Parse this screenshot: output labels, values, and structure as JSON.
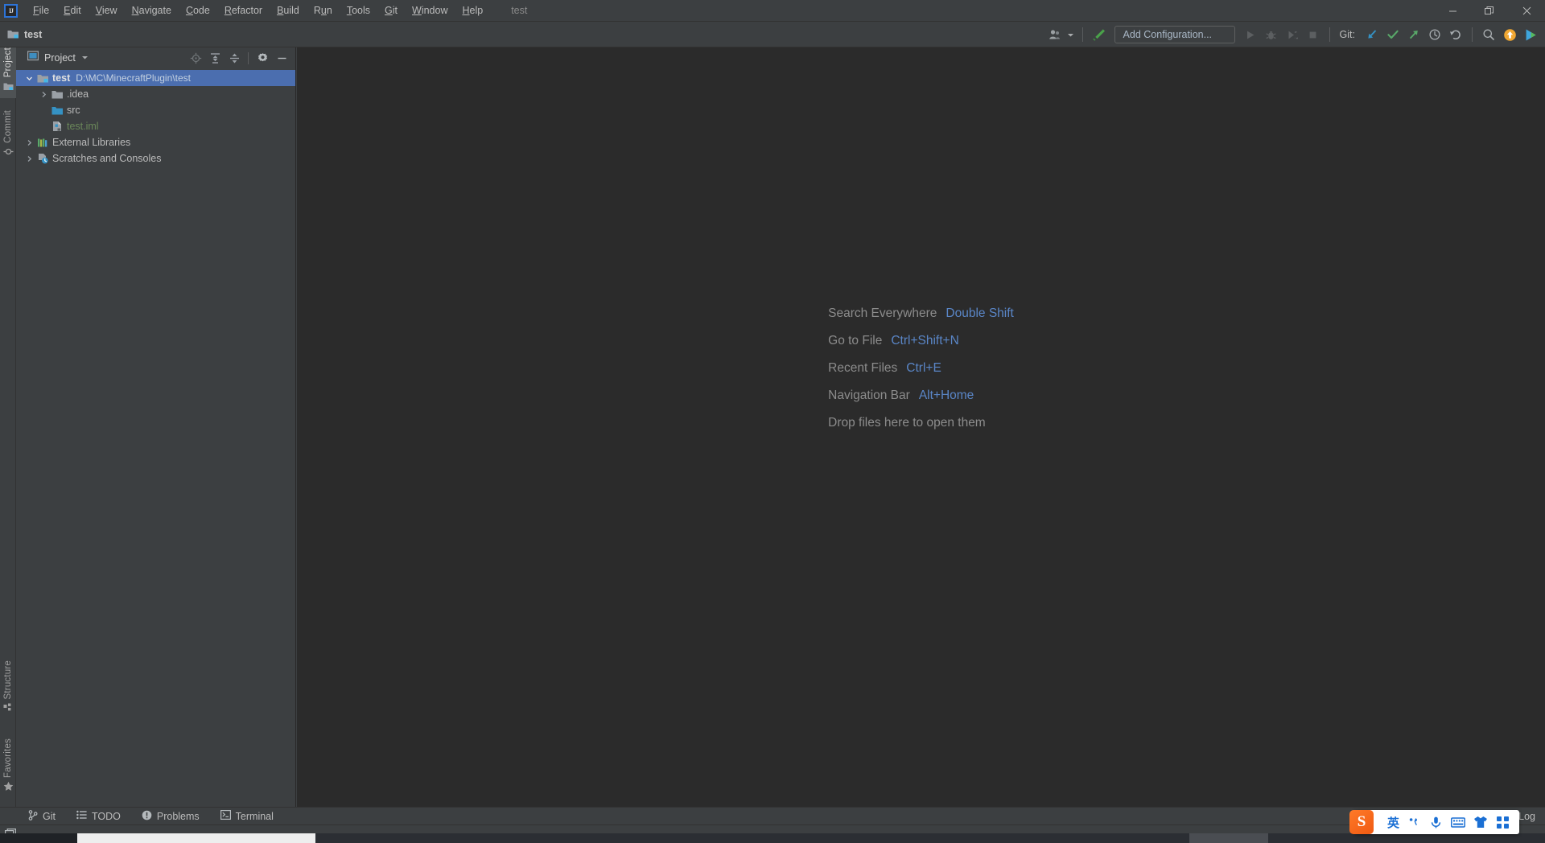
{
  "window": {
    "title": "test",
    "controls": {
      "minimize": "minimize-button",
      "restore": "restore-button",
      "close": "close-button"
    }
  },
  "menubar": {
    "items": [
      {
        "label": "File",
        "mnemonic": "F"
      },
      {
        "label": "Edit",
        "mnemonic": "E"
      },
      {
        "label": "View",
        "mnemonic": "V"
      },
      {
        "label": "Navigate",
        "mnemonic": "N"
      },
      {
        "label": "Code",
        "mnemonic": "C"
      },
      {
        "label": "Refactor",
        "mnemonic": "R"
      },
      {
        "label": "Build",
        "mnemonic": "B"
      },
      {
        "label": "Run",
        "mnemonic": "u"
      },
      {
        "label": "Tools",
        "mnemonic": "T"
      },
      {
        "label": "Git",
        "mnemonic": "G"
      },
      {
        "label": "Window",
        "mnemonic": "W"
      },
      {
        "label": "Help",
        "mnemonic": "H"
      }
    ],
    "logo_text": "IJ"
  },
  "navbar": {
    "project_name": "test"
  },
  "toolbar": {
    "run_configuration_label": "Add Configuration...",
    "git_label": "Git:",
    "buttons": [
      {
        "name": "profiler-icon",
        "enabled": true
      },
      {
        "name": "chevron-down-icon",
        "enabled": true
      },
      {
        "name": "build-hammer-icon",
        "enabled": true
      },
      {
        "name": "run-icon",
        "enabled": false
      },
      {
        "name": "debug-icon",
        "enabled": false
      },
      {
        "name": "run-with-coverage-icon",
        "enabled": false
      },
      {
        "name": "stop-icon",
        "enabled": false
      },
      {
        "name": "git-update-icon",
        "enabled": true
      },
      {
        "name": "git-commit-icon",
        "enabled": true
      },
      {
        "name": "git-push-icon",
        "enabled": true
      },
      {
        "name": "git-history-icon",
        "enabled": true
      },
      {
        "name": "git-rollback-icon",
        "enabled": true
      },
      {
        "name": "search-everywhere-icon",
        "enabled": true
      },
      {
        "name": "updates-available-icon",
        "enabled": true
      },
      {
        "name": "ide-play-icon",
        "enabled": true
      }
    ]
  },
  "stripe": {
    "left_top": [
      {
        "label": "Project",
        "icon": "project-folder-icon",
        "active": true
      },
      {
        "label": "Commit",
        "icon": "commit-icon",
        "active": false
      }
    ],
    "left_bottom": [
      {
        "label": "Structure",
        "icon": "structure-grid-icon",
        "active": false
      },
      {
        "label": "Favorites",
        "icon": "star-icon",
        "active": false
      }
    ]
  },
  "project_panel": {
    "title": "Project",
    "actions": [
      {
        "name": "select-opened-file-icon"
      },
      {
        "name": "expand-all-icon"
      },
      {
        "name": "collapse-all-icon"
      },
      {
        "name": "settings-gear-icon"
      },
      {
        "name": "hide-panel-icon"
      }
    ],
    "tree": [
      {
        "name": "test",
        "path": "D:\\MC\\MinecraftPlugin\\test",
        "icon": "module-folder-icon",
        "depth": 0,
        "expanded": true,
        "selected": true,
        "has_arrow": true,
        "style": "bold"
      },
      {
        "name": ".idea",
        "path": "",
        "icon": "folder-icon",
        "depth": 1,
        "expanded": false,
        "selected": false,
        "has_arrow": true,
        "style": "normal"
      },
      {
        "name": "src",
        "path": "",
        "icon": "source-folder-icon",
        "depth": 1,
        "expanded": false,
        "selected": false,
        "has_arrow": false,
        "style": "normal"
      },
      {
        "name": "test.iml",
        "path": "",
        "icon": "iml-file-icon",
        "depth": 1,
        "expanded": false,
        "selected": false,
        "has_arrow": false,
        "style": "green"
      },
      {
        "name": "External Libraries",
        "path": "",
        "icon": "libraries-icon",
        "depth": 0,
        "expanded": false,
        "selected": false,
        "has_arrow": true,
        "style": "normal"
      },
      {
        "name": "Scratches and Consoles",
        "path": "",
        "icon": "scratches-icon",
        "depth": 0,
        "expanded": false,
        "selected": false,
        "has_arrow": true,
        "style": "normal"
      }
    ]
  },
  "editor": {
    "hints": [
      {
        "label": "Search Everywhere",
        "key": "Double Shift"
      },
      {
        "label": "Go to File",
        "key": "Ctrl+Shift+N"
      },
      {
        "label": "Recent Files",
        "key": "Ctrl+E"
      },
      {
        "label": "Navigation Bar",
        "key": "Alt+Home"
      },
      {
        "label": "Drop files here to open them",
        "key": ""
      }
    ]
  },
  "bottom_bar": {
    "tabs": [
      {
        "label": "Git",
        "icon": "git-branch-icon"
      },
      {
        "label": "TODO",
        "icon": "todo-list-icon"
      },
      {
        "label": "Problems",
        "icon": "problems-icon"
      },
      {
        "label": "Terminal",
        "icon": "terminal-icon"
      }
    ],
    "event_log": {
      "label": "Event Log",
      "icon": "event-log-icon"
    }
  },
  "status_bar": {
    "icon": "toggle-toolwindows-icon"
  },
  "ime": {
    "name": "sogou-input-method",
    "logo": "S",
    "mode_label": "英",
    "items": [
      {
        "name": "punctuation-icon"
      },
      {
        "name": "microphone-icon"
      },
      {
        "name": "soft-keyboard-icon"
      },
      {
        "name": "skin-shirt-icon"
      },
      {
        "name": "toolbox-grid-icon"
      }
    ]
  },
  "colors": {
    "chrome": "#3c3f41",
    "editor_bg": "#2b2b2b",
    "selection": "#4b6eaf",
    "accent_blue": "#5a86c7",
    "green_text": "#6a8759",
    "text": "#bbbbbb"
  }
}
